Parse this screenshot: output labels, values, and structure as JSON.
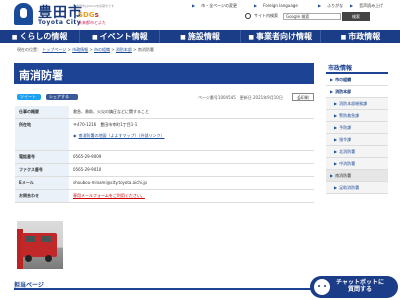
{
  "header": {
    "logo_text": "豊田市",
    "logo_sub": "Toyota City",
    "sdgs_top": "豊田市はSDGs未来都市です",
    "sdgs": {
      "a": "SDG",
      "b": "s",
      "c": "未来都市とよた"
    },
    "sdgs_sub": "未来都市とよた",
    "links": [
      "外国語",
      "市・全ページの変更",
      "Foreign language",
      "ふりがな",
      "音声読み上げ"
    ],
    "search_label": "サイト内検索",
    "search_placeholder": "Google 検索",
    "search_button": "検索"
  },
  "nav": [
    {
      "label": "くらしの情報",
      "icon": "home-icon"
    },
    {
      "label": "イベント情報",
      "icon": "event-icon"
    },
    {
      "label": "施設情報",
      "icon": "building-icon"
    },
    {
      "label": "事業者向け情報",
      "icon": "business-icon"
    },
    {
      "label": "市政情報",
      "icon": "city-icon"
    }
  ],
  "breadcrumb": {
    "prefix": "現在の位置：",
    "items": [
      "トップページ",
      "市政情報",
      "市の組織",
      "消防本部"
    ],
    "current": "南消防署"
  },
  "page": {
    "title": "南消防署",
    "tweet": "ツイート",
    "facebook": "シェアする",
    "page_id": "ページ番号1004545　更新日 2021年9月10日",
    "print": "印刷"
  },
  "table": [
    {
      "key": "仕事の概要",
      "value": "救急、救助、火災の鎮圧などに関すること"
    },
    {
      "key": "所在地",
      "value": "〒470-1216　豊田市幸町1丁目1-1",
      "link": "南消防署の地図（よよすマップ）（外部リンク）"
    },
    {
      "key": "電話番号",
      "value": "0565-29-9009"
    },
    {
      "key": "ファクス番号",
      "value": "0565-29-9010"
    },
    {
      "key": "Eメール",
      "value": "shoubou-minami@city.toyota.aichi.jp"
    },
    {
      "key": "お問合わせ",
      "value": "専用メールフォームをご利用ください。"
    }
  ],
  "bottom": {
    "heading": "担当ページ"
  },
  "sidebar": {
    "heading": "市政情報",
    "items": [
      {
        "label": "市の組織",
        "level": "lvl1"
      },
      {
        "label": "消防本部",
        "level": "lvl1"
      },
      {
        "label": "消防本部総務課",
        "level": "sub"
      },
      {
        "label": "警防救急課",
        "level": "sub"
      },
      {
        "label": "予防課",
        "level": "sub"
      },
      {
        "label": "指令課",
        "level": "sub"
      },
      {
        "label": "北消防署",
        "level": "sub"
      },
      {
        "label": "中消防署",
        "level": "sub"
      },
      {
        "label": "南消防署",
        "level": "cur"
      },
      {
        "label": "足助消防署",
        "level": "sub"
      }
    ]
  },
  "chatbot": {
    "line1": "チャットボットに",
    "line2": "質問する"
  },
  "colors": {
    "primary": "#1d4494",
    "nav": "#1b3c86",
    "label_bg": "#eaf1f8"
  }
}
